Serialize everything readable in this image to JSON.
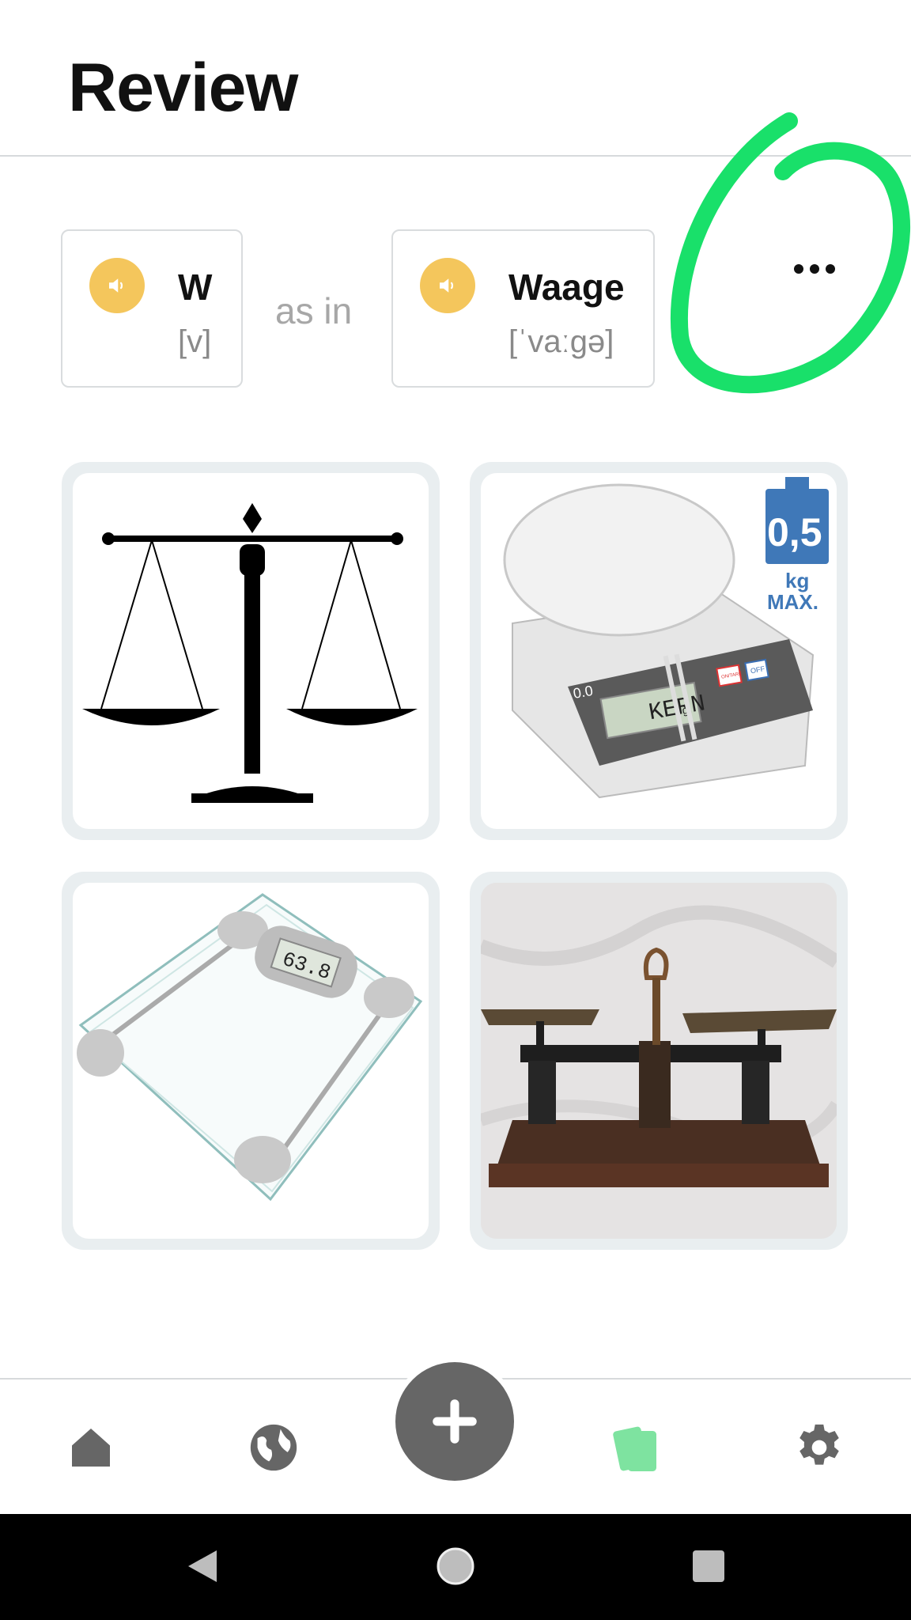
{
  "header": {
    "title": "Review"
  },
  "letter_card": {
    "letter": "W",
    "ipa": "[v]"
  },
  "connector": "as in",
  "word_card": {
    "word": "Waage",
    "ipa": "[ˈvaːɡə]"
  },
  "more_button": {
    "icon": "more-horizontal-icon"
  },
  "images": [
    {
      "name": "balance-scale-silhouette",
      "text": []
    },
    {
      "name": "kitchen-scale",
      "text": [
        "0,5",
        "kg",
        "MAX.",
        "KERN",
        "0.0",
        "g",
        "ON/TARE",
        "OFF"
      ]
    },
    {
      "name": "bathroom-scale",
      "text": [
        "63.8"
      ]
    },
    {
      "name": "antique-balance-scale",
      "text": []
    }
  ],
  "bottom_nav": [
    {
      "name": "home",
      "icon": "home-icon",
      "active": false
    },
    {
      "name": "explore",
      "icon": "globe-icon",
      "active": false
    },
    {
      "name": "add",
      "icon": "plus-icon",
      "active": false
    },
    {
      "name": "review",
      "icon": "cards-icon",
      "active": true
    },
    {
      "name": "settings",
      "icon": "gear-icon",
      "active": false
    }
  ],
  "colors": {
    "speaker": "#f4c65c",
    "active_nav": "#7ee3a0",
    "annotation": "#19e06a",
    "inactive_nav": "#666666"
  }
}
